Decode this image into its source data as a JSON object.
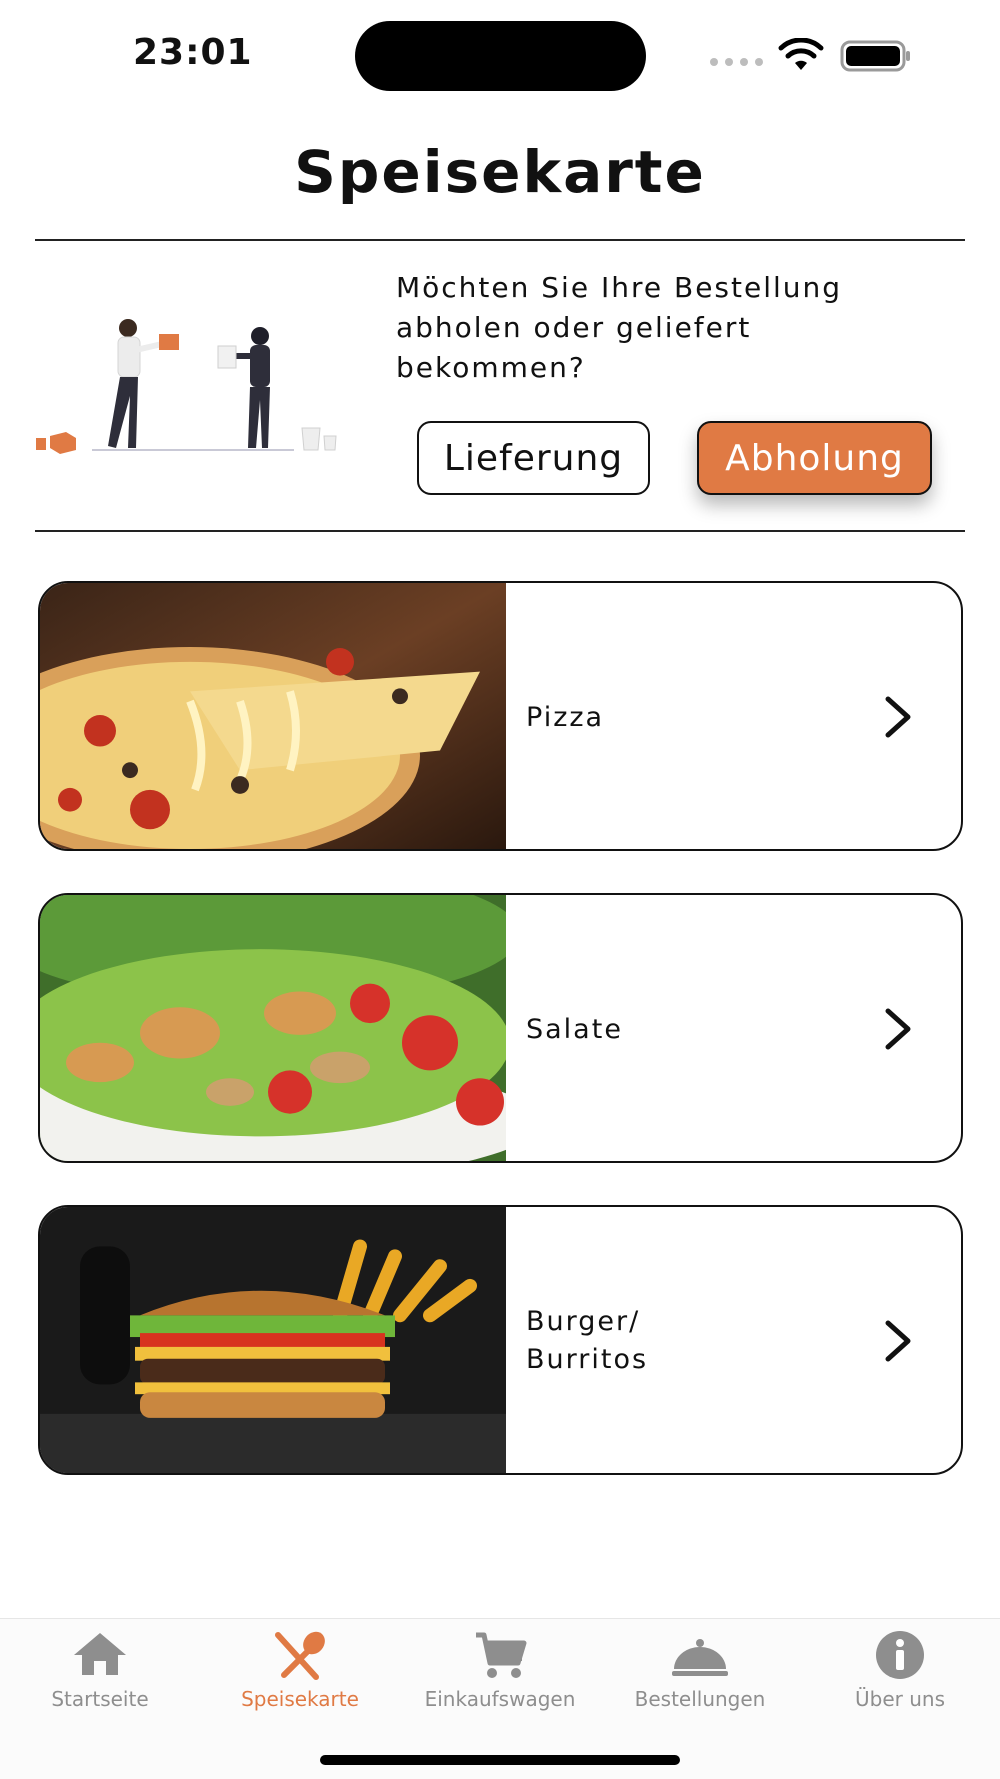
{
  "status_bar": {
    "time": "23:01"
  },
  "header": {
    "title": "Speisekarte"
  },
  "order_type": {
    "question": "Möchten Sie Ihre Bestellung abholen oder geliefert bekommen?",
    "delivery_label": "Lieferung",
    "pickup_label": "Abholung",
    "selected": "Abholung"
  },
  "categories": [
    {
      "label": "Pizza",
      "image": "pizza-photo"
    },
    {
      "label": "Salate",
      "image": "salad-photo"
    },
    {
      "label": "Burger/\nBurritos",
      "image": "burger-photo"
    }
  ],
  "tab_bar": {
    "items": [
      {
        "label": "Startseite",
        "icon": "home-icon"
      },
      {
        "label": "Speisekarte",
        "icon": "fork-spoon-icon",
        "active": true
      },
      {
        "label": "Einkaufswagen",
        "icon": "cart-icon"
      },
      {
        "label": "Bestellungen",
        "icon": "cloche-icon"
      },
      {
        "label": "Über uns",
        "icon": "info-icon"
      }
    ]
  },
  "colors": {
    "accent": "#e07a44",
    "inactive": "#8e8e8e",
    "text": "#111111"
  }
}
